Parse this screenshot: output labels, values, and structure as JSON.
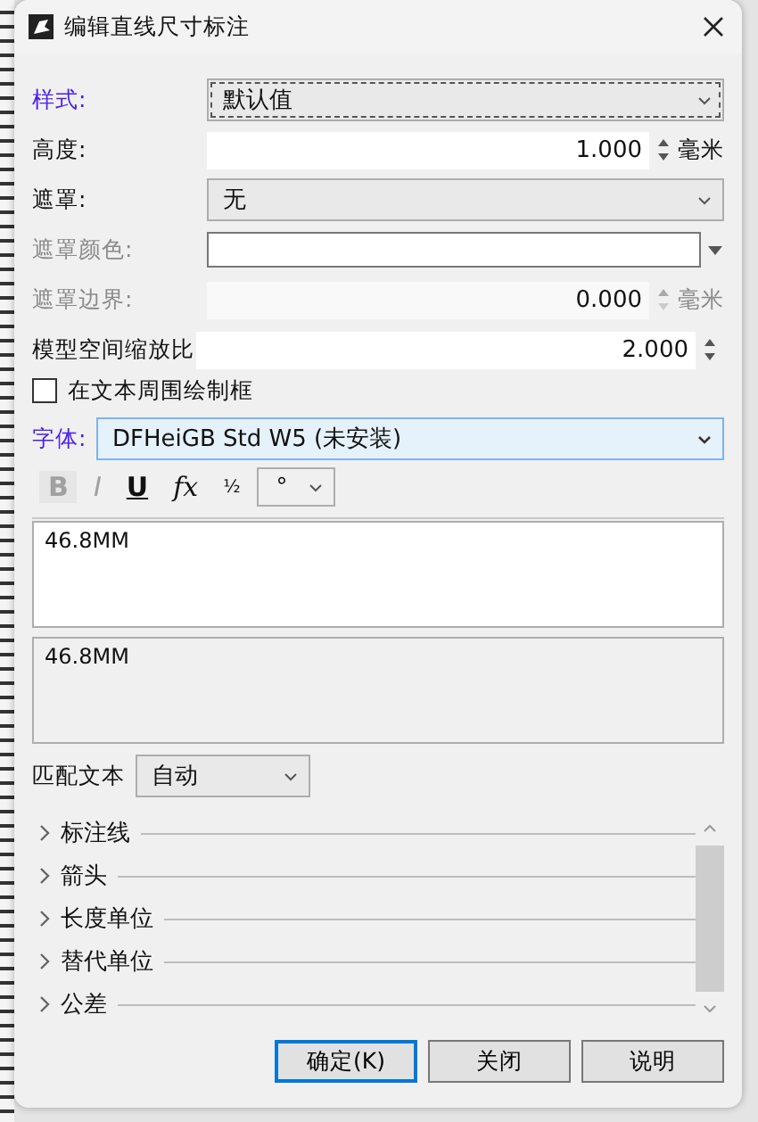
{
  "window": {
    "title": "编辑直线尺寸标注"
  },
  "fields": [
    {
      "kind": "dropdown",
      "label": "样式:",
      "value": "默认值",
      "highlighted": true
    },
    {
      "kind": "number",
      "label": "高度:",
      "value": "1.000",
      "unit": "毫米",
      "disabled": false
    },
    {
      "kind": "dropdown",
      "label": "遮罩:",
      "value": "无",
      "highlighted": false
    },
    {
      "kind": "color",
      "label": "遮罩颜色:",
      "disabled": true
    },
    {
      "kind": "number",
      "label": "遮罩边界:",
      "value": "0.000",
      "unit": "毫米",
      "disabled": true
    },
    {
      "kind": "number",
      "label": "模型空间缩放比",
      "value": "2.000",
      "disabled": false
    }
  ],
  "frame_checkbox": {
    "label": "在文本周围绘制框",
    "checked": false
  },
  "font": {
    "label": "字体:",
    "value": "DFHeiGB Std W5 (未安装)"
  },
  "format_toolbar": [
    {
      "kind": "bold",
      "label": "B",
      "disabled": true
    },
    {
      "kind": "italic",
      "label": "I",
      "disabled": true
    },
    {
      "kind": "underline",
      "label": "U",
      "disabled": false
    },
    {
      "kind": "fx",
      "label": "fx",
      "disabled": false
    },
    {
      "kind": "fraction",
      "label": "½",
      "disabled": false
    },
    {
      "kind": "symbol",
      "label": "°"
    }
  ],
  "text_input": {
    "value": "46.8MM"
  },
  "preview": {
    "text": "46.8MM"
  },
  "match_text": {
    "label": "匹配文本",
    "value": "自动"
  },
  "sections": [
    {
      "label": "标注线",
      "expanded": false
    },
    {
      "label": "箭头",
      "expanded": false
    },
    {
      "label": "长度单位",
      "expanded": false
    },
    {
      "label": "替代单位",
      "expanded": false
    },
    {
      "label": "公差",
      "expanded": false
    }
  ],
  "buttons": [
    {
      "label": "确定(K)",
      "default": true
    },
    {
      "label": "关闭",
      "default": false
    },
    {
      "label": "说明",
      "default": false
    }
  ]
}
